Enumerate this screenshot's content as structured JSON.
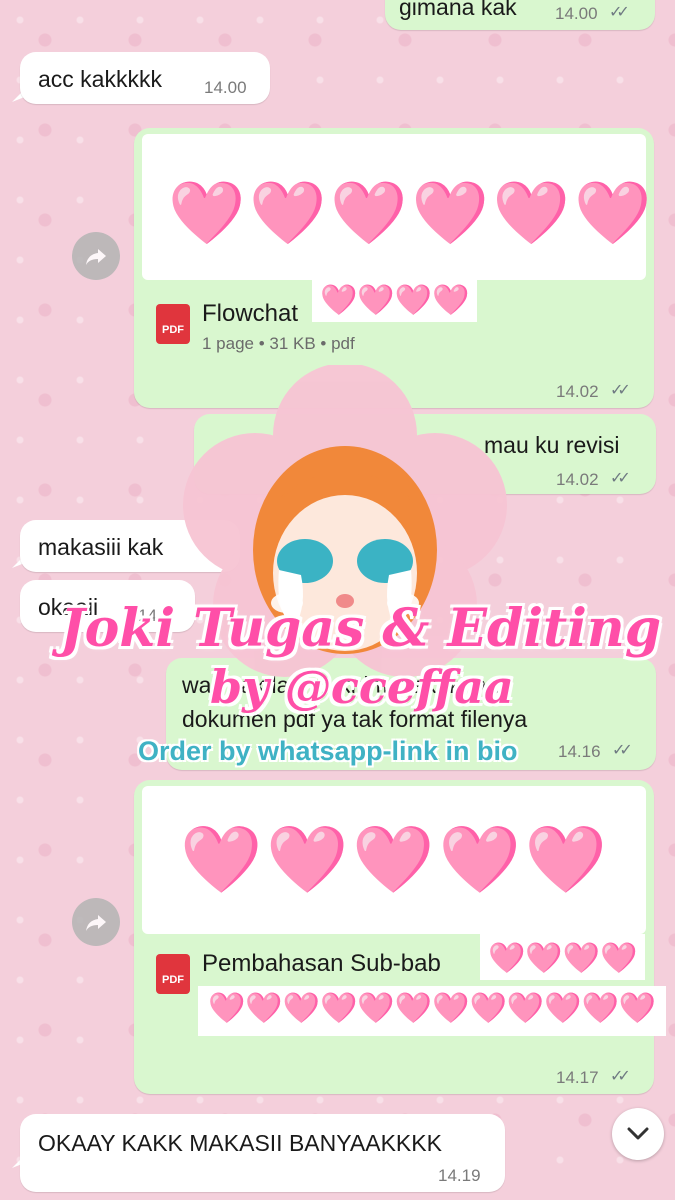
{
  "messages": {
    "m1": {
      "text": "gimana kak",
      "time": "14.00"
    },
    "m2": {
      "text": "acc kakkkkk",
      "time": "14.00"
    },
    "m3": {
      "hearts": "🩷🩷🩷🩷🩷🩷",
      "file_name": "Flowchat",
      "name_hearts": "🩷🩷🩷🩷",
      "file_meta": "1 page • 31 KB • pdf",
      "file_type": "PDF",
      "time": "14.02"
    },
    "m4": {
      "text": "mau ku revisi",
      "time": "14.02"
    },
    "m5": {
      "text": "makasiii  kak"
    },
    "m6": {
      "text": "okaaii",
      "time": "14.0"
    },
    "m7": {
      "line1": "wait kak   lagi m  kirim, kakak mau",
      "line2": "dokumen pdf ya  tak format filenya",
      "time": "14.16"
    },
    "m8": {
      "hearts": "🩷🩷🩷🩷🩷",
      "file_name": "Pembahasan Sub-bab",
      "name_hearts": "🩷🩷🩷🩷",
      "name_hearts2": "🩷🩷🩷🩷🩷🩷🩷🩷🩷🩷🩷🩷",
      "file_type": "PDF",
      "time": "14.17"
    },
    "m9": {
      "text": "OKAAY KAKK MAKASII BANYAAKKKK",
      "time": "14.19"
    }
  },
  "overlay": {
    "title": "Joki Tugas & Editing",
    "by": "by @cceffaa",
    "order": "Order by whatsapp-link in bio"
  },
  "icons": {
    "forward": "forward-arrow-icon",
    "read_receipt": "double-check-icon",
    "scroll_down": "chevron-down-icon",
    "file": "pdf-file-icon"
  },
  "colors": {
    "outgoing_bubble": "#d9f7cf",
    "incoming_bubble": "#ffffff",
    "wallpaper": "#f4cfdb",
    "promo_pink": "#ff4fa8",
    "promo_teal": "#3fb2c4"
  }
}
